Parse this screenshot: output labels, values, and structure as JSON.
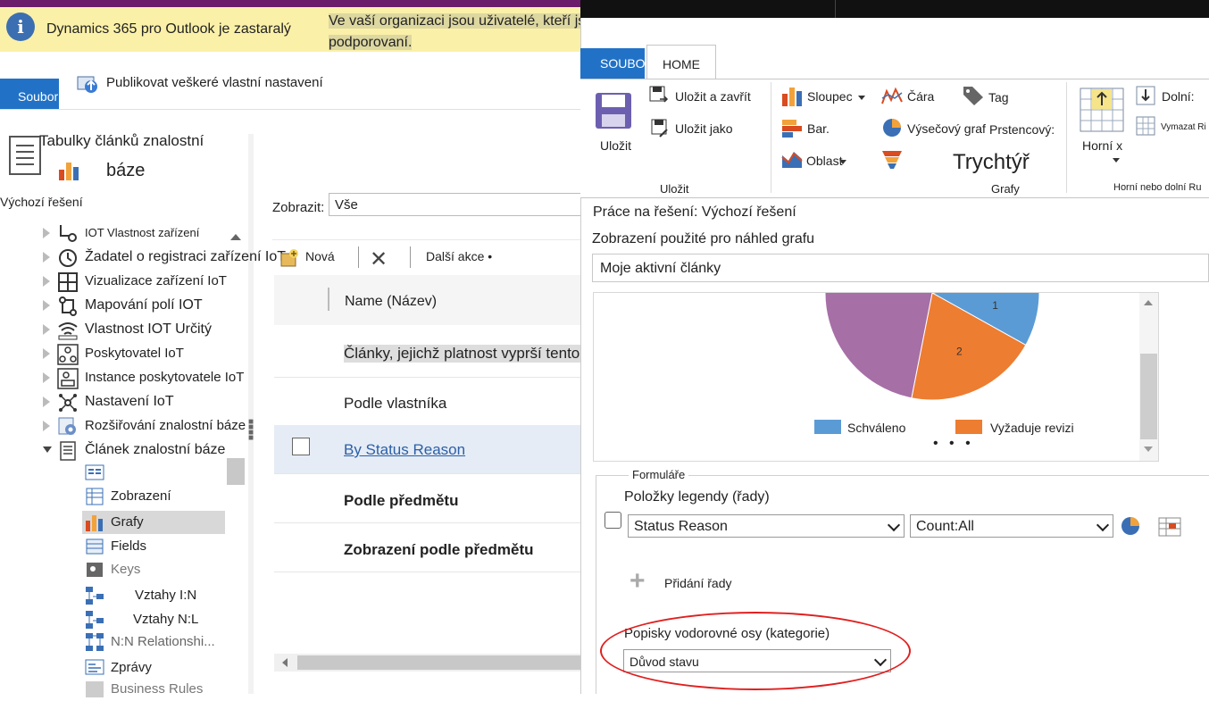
{
  "warning": {
    "title": "Dynamics 365 pro Outlook je zastaralý",
    "detail": "Ve vaší organizaci jsou uživatelé, kteří jsou podporovaní."
  },
  "left_ribbon": {
    "file_tab": "Soubor",
    "publish_label": "Publikovat veškeré vlastní nastavení"
  },
  "entity": {
    "title_line1": "Tabulky článků znalostní",
    "title_line2": "báze",
    "solution": "Výchozí řešení"
  },
  "tree": {
    "items": [
      {
        "label": "IOT Vlastnost zařízení",
        "icon": "iot-device-icon"
      },
      {
        "label": "Žadatel o registraci zařízení IoT",
        "icon": "history-icon"
      },
      {
        "label": "Vizualizace zařízení IoT",
        "icon": "grid-icon"
      },
      {
        "label": "Mapování polí IOT",
        "icon": "mapping-icon"
      },
      {
        "label": "Vlastnost IOT Určitý",
        "icon": "wifi-icon"
      },
      {
        "label": "Poskytovatel IoT",
        "icon": "provider-icon"
      },
      {
        "label": "Instance poskytovatele IoT",
        "icon": "instance-icon"
      },
      {
        "label": "Nastavení IoT",
        "icon": "settings-network-icon"
      },
      {
        "label": "Rozšiřování znalostní báze",
        "icon": "gear-icon"
      },
      {
        "label": "Článek znalostní báze",
        "icon": "article-icon"
      }
    ],
    "sub_items": [
      {
        "label": "",
        "icon": "form-icon"
      },
      {
        "label": "Zobrazení",
        "icon": "view-icon"
      },
      {
        "label": "Grafy",
        "icon": "chart-icon"
      },
      {
        "label": "Fields",
        "icon": "fields-icon"
      },
      {
        "label": "Keys",
        "icon": "key-icon"
      },
      {
        "label": "Vztahy I:N",
        "icon": "relationship-icon"
      },
      {
        "label": "Vztahy N:L",
        "icon": "relationship-icon"
      },
      {
        "label": "N:N Relationshi...",
        "icon": "relationship-icon"
      },
      {
        "label": "Zprávy",
        "icon": "messages-icon"
      },
      {
        "label": "Business Rules",
        "icon": "rules-icon"
      }
    ]
  },
  "list": {
    "display_label": "Zobrazit:",
    "display_value": "Vše",
    "new_label": "Nová",
    "more_actions": "Další akce •",
    "column_name": "Name (Název)",
    "rows": [
      "Články, jejichž platnost vyprší tento měsíc, by",
      "Podle vlastníka",
      "By Status Reason",
      "Podle předmětu",
      "Zobrazení podle předmětu"
    ]
  },
  "dialog_ribbon": {
    "tab_file": "SOUBOR",
    "tab_home": "HOME",
    "save": "Uložit",
    "save_close": "Uložit a zavřít",
    "save_as": "Uložit jako",
    "group_save": "Uložit",
    "column": "Sloupec",
    "bar": "Bar.",
    "area": "Oblast",
    "line": "Čára",
    "pie": "Výsečový graf",
    "tag": "Tag",
    "donut": "Prstencový:",
    "funnel": "Trychtýř",
    "group_charts": "Grafy",
    "top_x": "Horní x",
    "bottom": "Dolní:",
    "clear": "Vymazat Ri",
    "group_topbottom": "Horní nebo dolní Ru"
  },
  "dialog": {
    "solution_work": "Práce na řešení: Výchozí řešení",
    "preview_view_label": "Zobrazení použité pro náhled grafu",
    "preview_view_value": "Moje aktivní články",
    "form_legend": "Formuláře",
    "legend_items_label": "Položky legendy (řady)",
    "series_field": "Status Reason",
    "series_agg": "Count:All",
    "add_series": "Přidání řady",
    "axis_label": "Popisky vodorovné osy (kategorie)",
    "axis_value": "Důvod stavu"
  },
  "chart_data": {
    "type": "pie",
    "categories": [
      "Schváleno",
      "Vyžaduje revizi",
      ""
    ],
    "values": [
      1,
      2,
      7
    ],
    "data_labels": [
      "1",
      "2",
      ""
    ],
    "colors": [
      "#5b9bd5",
      "#ed7d31",
      "#a66fa6"
    ],
    "legend": [
      "Schváleno",
      "Vyžaduje revizi"
    ],
    "legend_position": "bottom"
  }
}
